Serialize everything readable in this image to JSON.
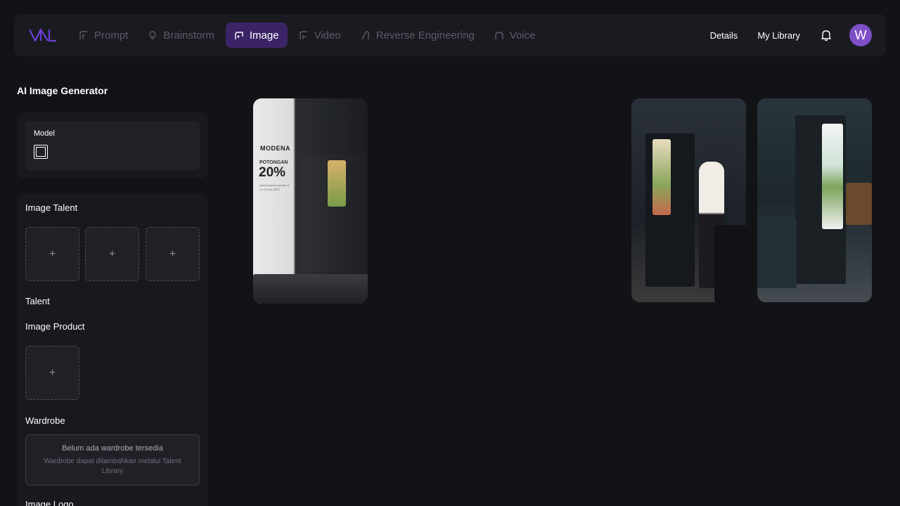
{
  "nav": {
    "tabs": [
      {
        "label": "Prompt",
        "icon": "prompt-icon",
        "active": false
      },
      {
        "label": "Brainstorm",
        "icon": "bulb-icon",
        "active": false
      },
      {
        "label": "Image",
        "icon": "image-icon",
        "active": true
      },
      {
        "label": "Video",
        "icon": "video-icon",
        "active": false
      },
      {
        "label": "Reverse Engineering",
        "icon": "reverse-icon",
        "active": false
      },
      {
        "label": "Voice",
        "icon": "voice-icon",
        "active": false
      }
    ],
    "details_label": "Details",
    "library_label": "My Library",
    "avatar_initial": "W"
  },
  "sidebar": {
    "title": "AI Image Generator",
    "model_label": "Model",
    "image_talent_label": "Image Talent",
    "slot_plus": "+",
    "talent_label": "Talent",
    "image_product_label": "Image Product",
    "wardrobe_label": "Wardrobe",
    "wardrobe_empty_title": "Belum ada wardrobe tersedia",
    "wardrobe_empty_sub": "Wardrobe dapat ditambahkan melalui Talent Library",
    "image_logo_label": "Image Logo"
  },
  "gallery": {
    "promo": {
      "brand": "MODENA",
      "label": "POTONGAN",
      "value": "20%",
      "sub": "www.modena.com/id_id 12-15 Des 2025"
    }
  },
  "colors": {
    "background": "#121317",
    "navbar": "#1a1b20",
    "active_tab": "#3b2466",
    "avatar": "#7d4fc7",
    "panel": "#18191e"
  }
}
